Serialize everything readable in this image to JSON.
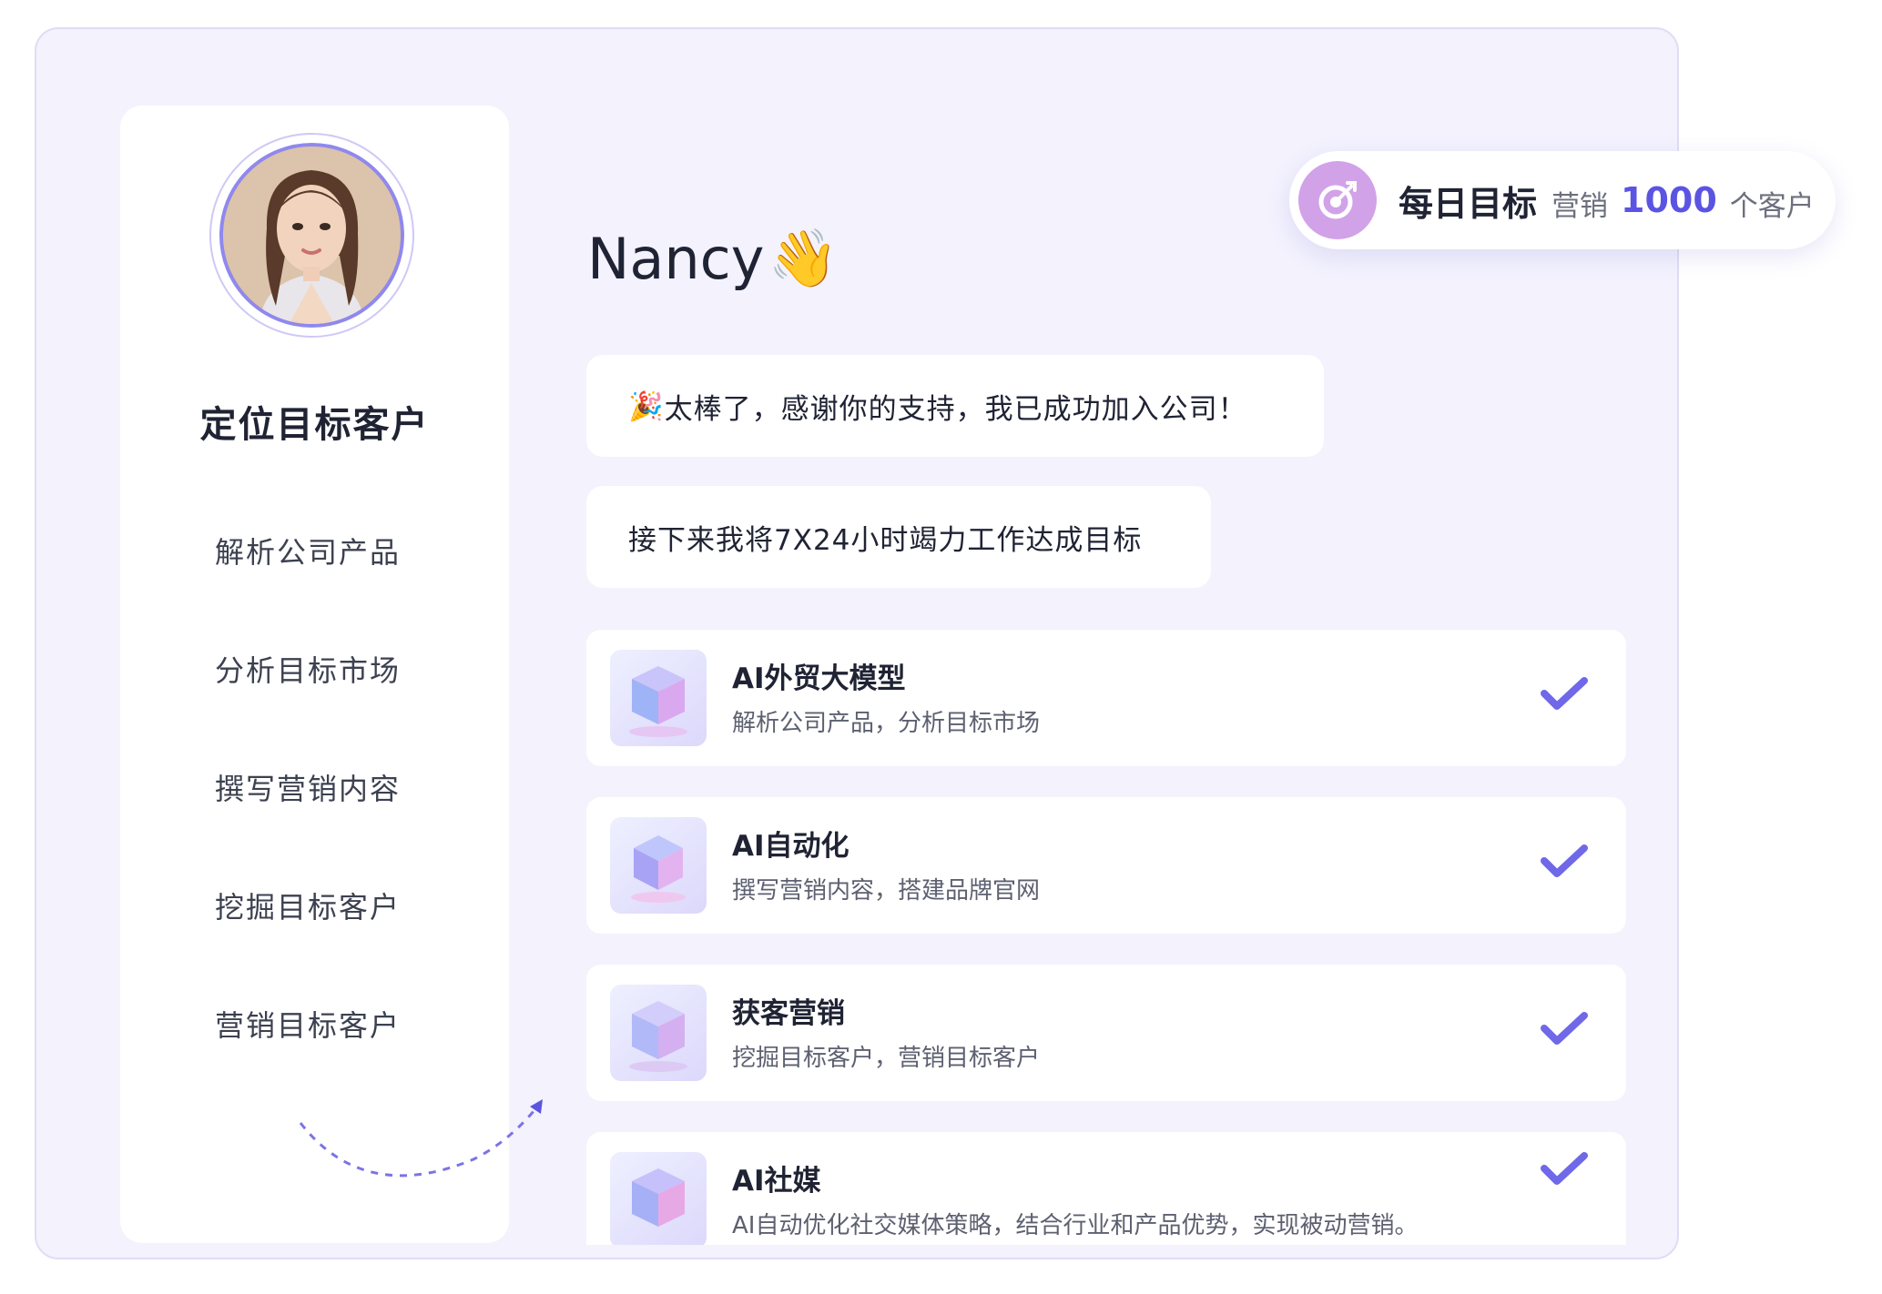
{
  "goal": {
    "icon": "target-icon",
    "title": "每日目标",
    "prefix": "营销",
    "number": "1000",
    "suffix": "个客户"
  },
  "sidebar": {
    "title": "定位目标客户",
    "items": [
      {
        "label": "解析公司产品"
      },
      {
        "label": "分析目标市场"
      },
      {
        "label": "撰写营销内容"
      },
      {
        "label": "挖掘目标客户"
      },
      {
        "label": "营销目标客户"
      }
    ]
  },
  "chat": {
    "name": "Nancy",
    "wave": "👋",
    "messages": [
      {
        "emoji": "🎉",
        "text": "太棒了，感谢你的支持，我已成功加入公司！"
      },
      {
        "text": "接下来我将7X24小时竭力工作达成目标"
      }
    ]
  },
  "cards": [
    {
      "title": "AI外贸大模型",
      "desc": "解析公司产品，分析目标市场",
      "icon": "cube-icon"
    },
    {
      "title": "AI自动化",
      "desc": "撰写营销内容，搭建品牌官网",
      "icon": "cube-icon"
    },
    {
      "title": "获客营销",
      "desc": "挖掘目标客户，营销目标客户",
      "icon": "cube-icon"
    },
    {
      "title": "AI社媒",
      "desc": "AI自动优化社交媒体策略，结合行业和产品优势，实现被动营销。",
      "icon": "cube-icon"
    }
  ],
  "colors": {
    "panel_bg": "#f3f2fd",
    "accent": "#5b54e2",
    "check": "#6f68e8",
    "goal_icon_bg": "#d2a2e8"
  }
}
